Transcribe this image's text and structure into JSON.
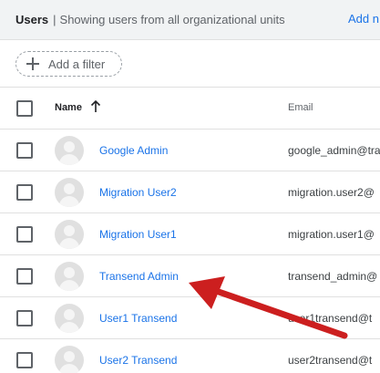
{
  "header": {
    "title": "Users",
    "separator": "|",
    "subtitle": "Showing users from all organizational units",
    "add_link": "Add n"
  },
  "filter": {
    "label": "Add a filter",
    "icon": "plus-icon"
  },
  "table": {
    "columns": {
      "name": "Name",
      "email": "Email"
    },
    "sort": {
      "column": "Name",
      "direction": "ascending",
      "icon": "arrow-up-icon"
    },
    "rows": [
      {
        "name": "Google Admin",
        "email": "google_admin@tra"
      },
      {
        "name": "Migration User2",
        "email": "migration.user2@"
      },
      {
        "name": "Migration User1",
        "email": "migration.user1@"
      },
      {
        "name": "Transend Admin",
        "email": "transend_admin@"
      },
      {
        "name": "User1 Transend",
        "email": "user1transend@t"
      },
      {
        "name": "User2 Transend",
        "email": "user2transend@t"
      }
    ]
  },
  "annotation": {
    "type": "arrow",
    "points_to": "Transend Admin",
    "color": "#cc1f1f"
  },
  "colors": {
    "link": "#1a73e8",
    "header_bg": "#f1f3f4",
    "divider": "#e0e0e0"
  }
}
